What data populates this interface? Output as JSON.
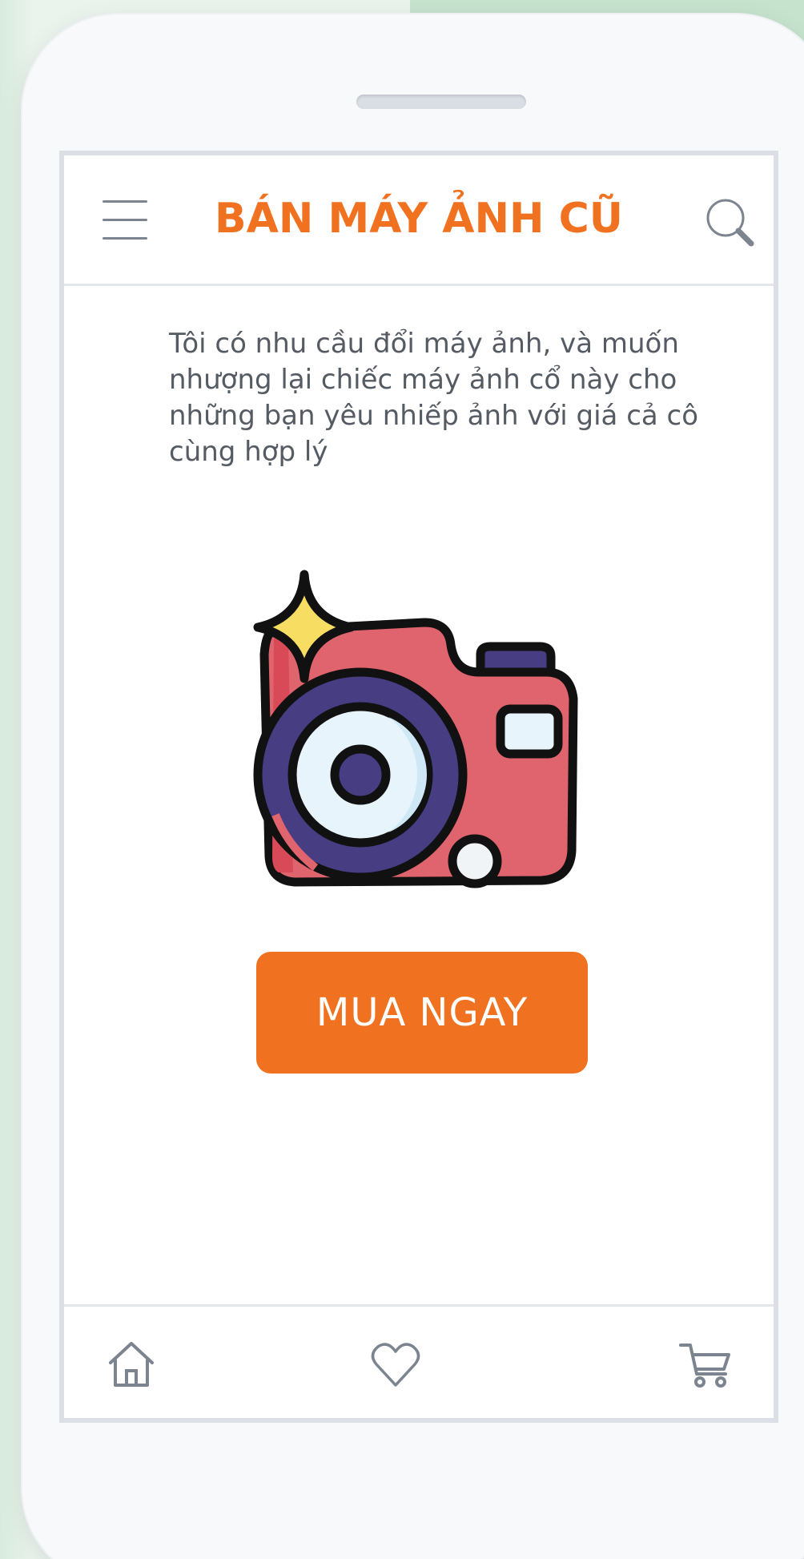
{
  "header": {
    "title": "BÁN MÁY ẢNH CŨ",
    "menu_icon": "hamburger-menu-icon",
    "search_icon": "search-icon"
  },
  "main": {
    "description": "Tôi có nhu cầu đổi máy ảnh, và muốn nhượng lại chiếc máy ảnh cổ này cho những bạn yêu nhiếp ảnh với giá cả cô cùng hợp lý",
    "illustration_icon": "camera-icon",
    "buy_button_label": "MUA NGAY"
  },
  "bottom_nav": {
    "items": [
      {
        "icon": "home-icon"
      },
      {
        "icon": "heart-icon"
      },
      {
        "icon": "cart-icon"
      }
    ]
  },
  "colors": {
    "accent": "#f07220",
    "text": "#555b63",
    "icon": "#7c8490",
    "camera_body": "#e0646d",
    "camera_lens": "#473d83",
    "sparkle": "#f7dd62"
  }
}
